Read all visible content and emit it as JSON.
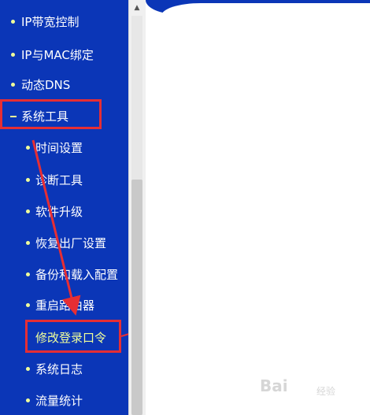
{
  "menu": {
    "items": [
      {
        "label": "IP带宽控制",
        "level": "top",
        "marker": "bullet",
        "active": false
      },
      {
        "label": "IP与MAC绑定",
        "level": "top",
        "marker": "bullet",
        "active": false
      },
      {
        "label": "动态DNS",
        "level": "top",
        "marker": "bullet",
        "active": false
      },
      {
        "label": "系统工具",
        "level": "top",
        "marker": "dash",
        "active": false
      },
      {
        "label": "时间设置",
        "level": "sub",
        "marker": "bullet",
        "active": false
      },
      {
        "label": "诊断工具",
        "level": "sub",
        "marker": "bullet",
        "active": false
      },
      {
        "label": "软件升级",
        "level": "sub",
        "marker": "bullet",
        "active": false
      },
      {
        "label": "恢复出厂设置",
        "level": "sub",
        "marker": "bullet",
        "active": false
      },
      {
        "label": "备份和载入配置",
        "level": "sub",
        "marker": "bullet",
        "active": false
      },
      {
        "label": "重启路由器",
        "level": "sub",
        "marker": "bullet",
        "active": false
      },
      {
        "label": "修改登录口令",
        "level": "sub",
        "marker": "bullet",
        "active": true
      },
      {
        "label": "系统日志",
        "level": "sub",
        "marker": "bullet",
        "active": false
      },
      {
        "label": "流量统计",
        "level": "sub",
        "marker": "bullet",
        "active": false
      }
    ]
  },
  "annotation": {
    "box_color": "#e62e34",
    "arrow_color": "#e62e34"
  },
  "watermark": {
    "text": "Bai",
    "sub": "经验"
  },
  "colors": {
    "sidebar_bg": "#0b36b7",
    "menu_text": "#ffffff",
    "active_text": "#f0ff9a"
  }
}
